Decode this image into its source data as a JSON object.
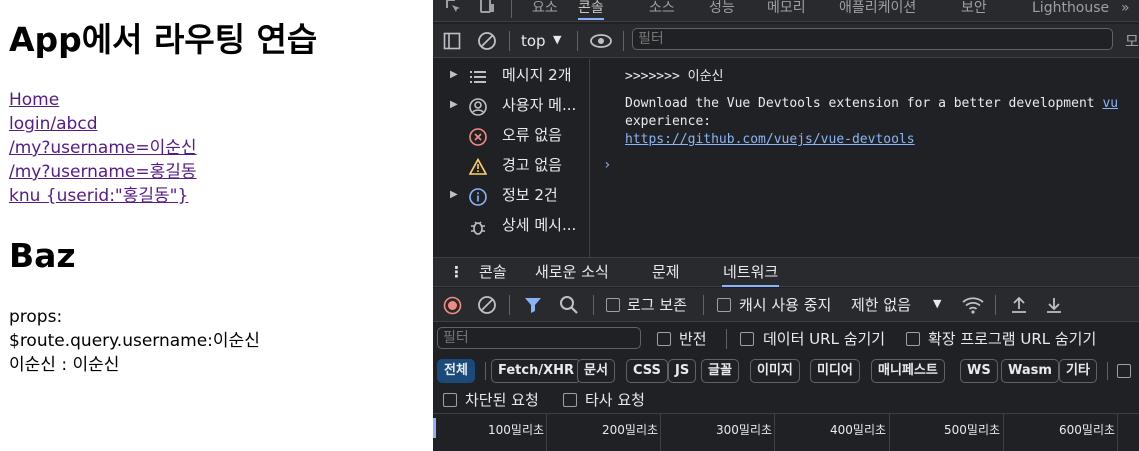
{
  "page": {
    "title": "App에서 라우팅 연습",
    "links": [
      "Home",
      "login/abcd",
      "/my?username=이순신",
      "/my?username=홍길동",
      "knu {userid:\"홍길동\"}"
    ],
    "sub_title": "Baz",
    "props_label": "props:",
    "query_line": "$route.query.username:이순신",
    "name_line": "이순신 : 이순신"
  },
  "devtools": {
    "panel_tabs": [
      "요소",
      "콘솔",
      "소스",
      "성능",
      "메모리",
      "애플리케이션",
      "보안",
      "Lighthouse"
    ],
    "active_panel": "콘솔",
    "context_select": "top",
    "filter_placeholder": "필터",
    "sidebar": [
      {
        "label": "메시지 2개",
        "icon": "list-icon",
        "expandable": true
      },
      {
        "label": "사용자 메...",
        "icon": "user-icon",
        "expandable": true
      },
      {
        "label": "오류 없음",
        "icon": "error-icon",
        "expandable": false
      },
      {
        "label": "경고 없음",
        "icon": "warning-icon",
        "expandable": false
      },
      {
        "label": "정보 2건",
        "icon": "info-icon",
        "expandable": true
      },
      {
        "label": "상세 메시...",
        "icon": "bug-icon",
        "expandable": false
      }
    ],
    "console": {
      "line1": ">>>>>>> 이순신",
      "line2_text": "Download the Vue Devtools extension for a better development",
      "line2_link_partial": "vu",
      "line2_cont": "experience:",
      "line2_url": "https://github.com/vuejs/vue-devtools",
      "prompt": "›"
    },
    "drawer_tabs": [
      "콘솔",
      "새로운 소식",
      "문제",
      "네트워크"
    ],
    "active_drawer": "네트워크",
    "network": {
      "preserve_log": "로그 보존",
      "disable_cache": "캐시 사용 중지",
      "throttle": "제한 없음",
      "filter_placeholder": "필터",
      "invert": "반전",
      "hide_data_urls": "데이터 URL 숨기기",
      "hide_ext_urls": "확장 프로그램 URL 숨기기",
      "chips": [
        "전체",
        "Fetch/XHR",
        "문서",
        "CSS",
        "JS",
        "글꼴",
        "이미지",
        "미디어",
        "매니페스트",
        "WS",
        "Wasm",
        "기타"
      ],
      "active_chip": "전체",
      "blocked_requests": "차단된 요청",
      "third_party": "타사 요청",
      "ticks": [
        "100밀리초",
        "200밀리초",
        "300밀리초",
        "400밀리초",
        "500밀리초",
        "600밀리초"
      ]
    },
    "colors": {
      "bg": "#202124",
      "toolbar": "#292a2d",
      "accent": "#8ab4f8",
      "record": "#f28b82",
      "link": "#551a8b"
    }
  }
}
